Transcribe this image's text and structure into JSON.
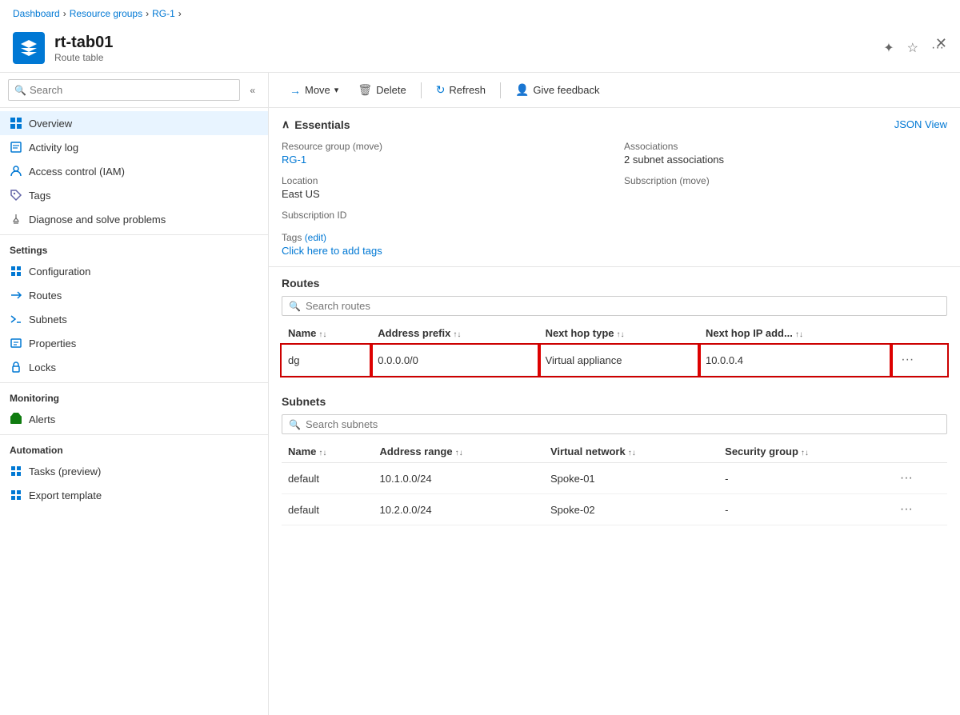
{
  "breadcrumb": {
    "items": [
      "Dashboard",
      "Resource groups",
      "RG-1"
    ]
  },
  "resource": {
    "name": "rt-tab01",
    "type": "Route table",
    "icon": "route-table-icon"
  },
  "header_icons": {
    "favorite": "★",
    "outline_favorite": "☆",
    "more": "···"
  },
  "search": {
    "placeholder": "Search"
  },
  "sidebar": {
    "nav_items": [
      {
        "id": "overview",
        "label": "Overview",
        "icon": "overview-icon",
        "active": true
      },
      {
        "id": "activity-log",
        "label": "Activity log",
        "icon": "activity-log-icon",
        "active": false
      },
      {
        "id": "access-control",
        "label": "Access control (IAM)",
        "icon": "iam-icon",
        "active": false
      },
      {
        "id": "tags",
        "label": "Tags",
        "icon": "tags-icon",
        "active": false
      },
      {
        "id": "diagnose",
        "label": "Diagnose and solve problems",
        "icon": "diagnose-icon",
        "active": false
      }
    ],
    "settings_section": "Settings",
    "settings_items": [
      {
        "id": "configuration",
        "label": "Configuration",
        "icon": "config-icon"
      },
      {
        "id": "routes",
        "label": "Routes",
        "icon": "routes-icon"
      },
      {
        "id": "subnets",
        "label": "Subnets",
        "icon": "subnets-icon"
      },
      {
        "id": "properties",
        "label": "Properties",
        "icon": "properties-icon"
      },
      {
        "id": "locks",
        "label": "Locks",
        "icon": "locks-icon"
      }
    ],
    "monitoring_section": "Monitoring",
    "monitoring_items": [
      {
        "id": "alerts",
        "label": "Alerts",
        "icon": "alerts-icon"
      }
    ],
    "automation_section": "Automation",
    "automation_items": [
      {
        "id": "tasks",
        "label": "Tasks (preview)",
        "icon": "tasks-icon"
      },
      {
        "id": "export",
        "label": "Export template",
        "icon": "export-icon"
      }
    ]
  },
  "toolbar": {
    "move_label": "Move",
    "delete_label": "Delete",
    "refresh_label": "Refresh",
    "feedback_label": "Give feedback"
  },
  "essentials": {
    "title": "Essentials",
    "json_view": "JSON View",
    "resource_group_label": "Resource group (move)",
    "resource_group_value": "RG-1",
    "associations_label": "Associations",
    "associations_value": "2 subnet associations",
    "location_label": "Location",
    "location_value": "East US",
    "subscription_label": "Subscription (move)",
    "subscription_value": "",
    "subscription_id_label": "Subscription ID",
    "subscription_id_value": "",
    "tags_label": "Tags (edit)",
    "tags_link": "Click here to add tags"
  },
  "routes_section": {
    "title": "Routes",
    "search_placeholder": "Search routes",
    "columns": [
      "Name",
      "Address prefix",
      "Next hop type",
      "Next hop IP add..."
    ],
    "rows": [
      {
        "name": "dg",
        "address_prefix": "0.0.0.0/0",
        "next_hop_type": "Virtual appliance",
        "next_hop_ip": "10.0.0.4",
        "highlighted": true
      }
    ]
  },
  "subnets_section": {
    "title": "Subnets",
    "search_placeholder": "Search subnets",
    "columns": [
      "Name",
      "Address range",
      "Virtual network",
      "Security group"
    ],
    "rows": [
      {
        "name": "default",
        "address_range": "10.1.0.0/24",
        "virtual_network": "Spoke-01",
        "security_group": "-"
      },
      {
        "name": "default",
        "address_range": "10.2.0.0/24",
        "virtual_network": "Spoke-02",
        "security_group": "-"
      }
    ]
  }
}
